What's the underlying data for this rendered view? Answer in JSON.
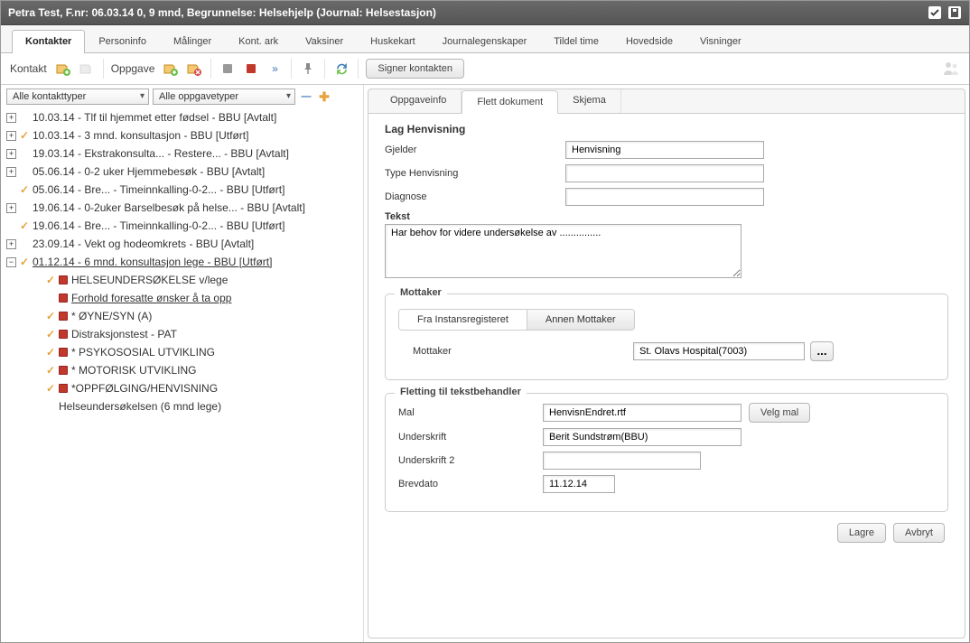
{
  "title_bar": "Petra Test, F.nr: 06.03.14 0, 9 mnd, Begrunnelse: Helsehjelp (Journal: Helsestasjon)",
  "main_tabs": [
    "Kontakter",
    "Personinfo",
    "Målinger",
    "Kont. ark",
    "Vaksiner",
    "Huskekart",
    "Journalegenskaper",
    "Tildel time",
    "Hovedside",
    "Visninger"
  ],
  "main_tab_active_index": 0,
  "toolbar": {
    "kontakt_label": "Kontakt",
    "oppgave_label": "Oppgave",
    "signer_label": "Signer kontakten"
  },
  "filters": {
    "kontakttype": "Alle kontakttyper",
    "oppgavetype": "Alle oppgavetyper"
  },
  "tree": [
    {
      "toggle": "+",
      "chk": "",
      "label": "10.03.14 - Tlf til hjemmet etter fødsel - BBU [Avtalt]"
    },
    {
      "toggle": "+",
      "chk": "✓",
      "label": "10.03.14 - 3 mnd. konsultasjon - BBU [Utført]"
    },
    {
      "toggle": "+",
      "chk": "",
      "label": "19.03.14 - Ekstrakonsulta... - Restere... - BBU [Avtalt]"
    },
    {
      "toggle": "+",
      "chk": "",
      "label": "05.06.14 - 0-2 uker Hjemmebesøk - BBU [Avtalt]"
    },
    {
      "toggle": "",
      "chk": "✓",
      "label": "05.06.14 - Bre... - Timeinnkalling-0-2... - BBU [Utført]"
    },
    {
      "toggle": "+",
      "chk": "",
      "label": "19.06.14 - 0-2uker Barselbesøk på helse... - BBU [Avtalt]"
    },
    {
      "toggle": "",
      "chk": "✓",
      "label": "19.06.14 - Bre... - Timeinnkalling-0-2... - BBU [Utført]"
    },
    {
      "toggle": "+",
      "chk": "",
      "label": "23.09.14 - Vekt og hodeomkrets - BBU [Avtalt]"
    },
    {
      "toggle": "−",
      "chk": "✓",
      "label": "01.12.14 - 6 mnd. konsultasjon lege - BBU [Utført]",
      "underline": true,
      "children": [
        {
          "chk": "✓",
          "bullet": "red",
          "label": "HELSEUNDERSØKELSE v/lege"
        },
        {
          "chk": "",
          "bullet": "red",
          "label": "Forhold foresatte ønsker å ta opp",
          "underline": true
        },
        {
          "chk": "✓",
          "bullet": "red",
          "label": "* ØYNE/SYN (A)"
        },
        {
          "chk": "✓",
          "bullet": "red",
          "label": "Distraksjonstest - PAT"
        },
        {
          "chk": "✓",
          "bullet": "red",
          "label": "* PSYKOSOSIAL UTVIKLING"
        },
        {
          "chk": "✓",
          "bullet": "red",
          "label": "* MOTORISK UTVIKLING"
        },
        {
          "chk": "✓",
          "bullet": "red",
          "label": "*OPPFØLGING/HENVISNING"
        },
        {
          "chk": "",
          "bullet": "",
          "label": "Helseundersøkelsen (6 mnd lege)"
        }
      ]
    }
  ],
  "sub_tabs": [
    "Oppgaveinfo",
    "Flett dokument",
    "Skjema"
  ],
  "sub_tab_active_index": 1,
  "form": {
    "heading": "Lag Henvisning",
    "gjelder_label": "Gjelder",
    "gjelder_value": "Henvisning",
    "type_label": "Type Henvisning",
    "type_value": "",
    "diagnose_label": "Diagnose",
    "diagnose_value": "",
    "tekst_label": "Tekst",
    "tekst_value": "Har behov for videre undersøkelse av ..............."
  },
  "mottaker_group": {
    "title": "Mottaker",
    "tabs": [
      "Fra Instansregisteret",
      "Annen Mottaker"
    ],
    "active_index": 0,
    "mottaker_label": "Mottaker",
    "mottaker_value": "St. Olavs Hospital(7003)"
  },
  "fletting_group": {
    "title": "Fletting til tekstbehandler",
    "mal_label": "Mal",
    "mal_value": "HenvisnEndret.rtf",
    "velg_mal_label": "Velg mal",
    "underskrift_label": "Underskrift",
    "underskrift_value": "Berit Sundstrøm(BBU)",
    "underskrift2_label": "Underskrift 2",
    "underskrift2_value": "",
    "brevdato_label": "Brevdato",
    "brevdato_value": "11.12.14"
  },
  "buttons": {
    "lagre": "Lagre",
    "avbryt": "Avbryt"
  }
}
